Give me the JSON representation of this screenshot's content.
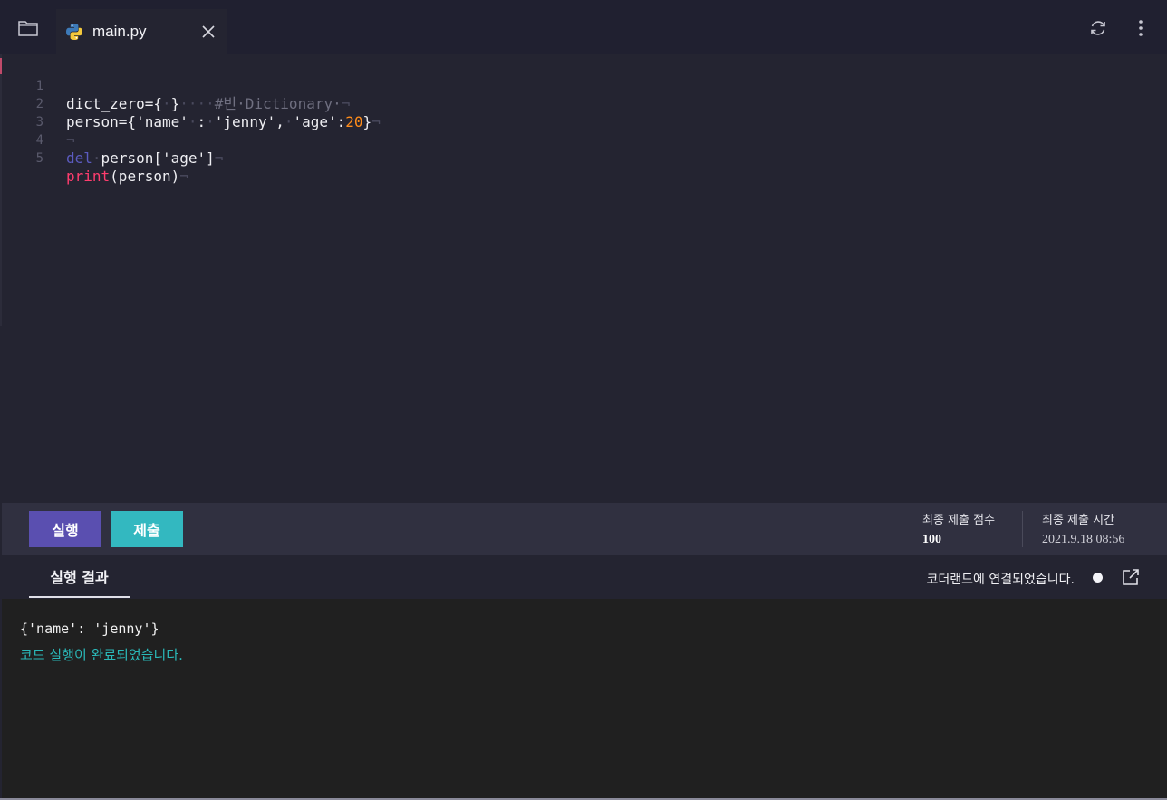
{
  "tab": {
    "label": "main.py"
  },
  "editor": {
    "lines": [
      {
        "num": "1"
      },
      {
        "num": "2"
      },
      {
        "num": "3"
      },
      {
        "num": "4"
      },
      {
        "num": "5"
      }
    ],
    "code": {
      "l1_a": "dict_zero={",
      "l1_b": "·",
      "l1_c": "}",
      "l1_d": "····",
      "l1_e": "#빈·Dictionary·",
      "l1_f": "¬",
      "l2_a": "person={'name'",
      "l2_b": "·",
      "l2_c": ":",
      "l2_d": "·",
      "l2_e": "'jenny',",
      "l2_f": "·",
      "l2_g": "'age':",
      "l2_h": "20",
      "l2_i": "}",
      "l2_j": "¬",
      "l3_a": "¬",
      "l4_a": "del",
      "l4_b": "·",
      "l4_c": "person['age']",
      "l4_d": "¬",
      "l5_a": "print",
      "l5_b": "(person)",
      "l5_c": "¬"
    }
  },
  "toolbar": {
    "run_label": "실행",
    "submit_label": "제출",
    "score_label": "최종 제출 점수",
    "score_value": "100",
    "time_label": "최종 제출 시간",
    "time_value": "2021.9.18 08:56"
  },
  "result": {
    "tab_label": "실행 결과",
    "status": "코더랜드에 연결되었습니다.",
    "output_line": "{'name': 'jenny'}",
    "done_message": "코드 실행이 완료되었습니다."
  },
  "colors": {
    "run": "#5a4fb0",
    "submit": "#33b8c0",
    "keyword": "#5b5bc0",
    "builtin": "#ff3d6e",
    "number": "#ff8c1a",
    "success": "#2ab9b9"
  }
}
